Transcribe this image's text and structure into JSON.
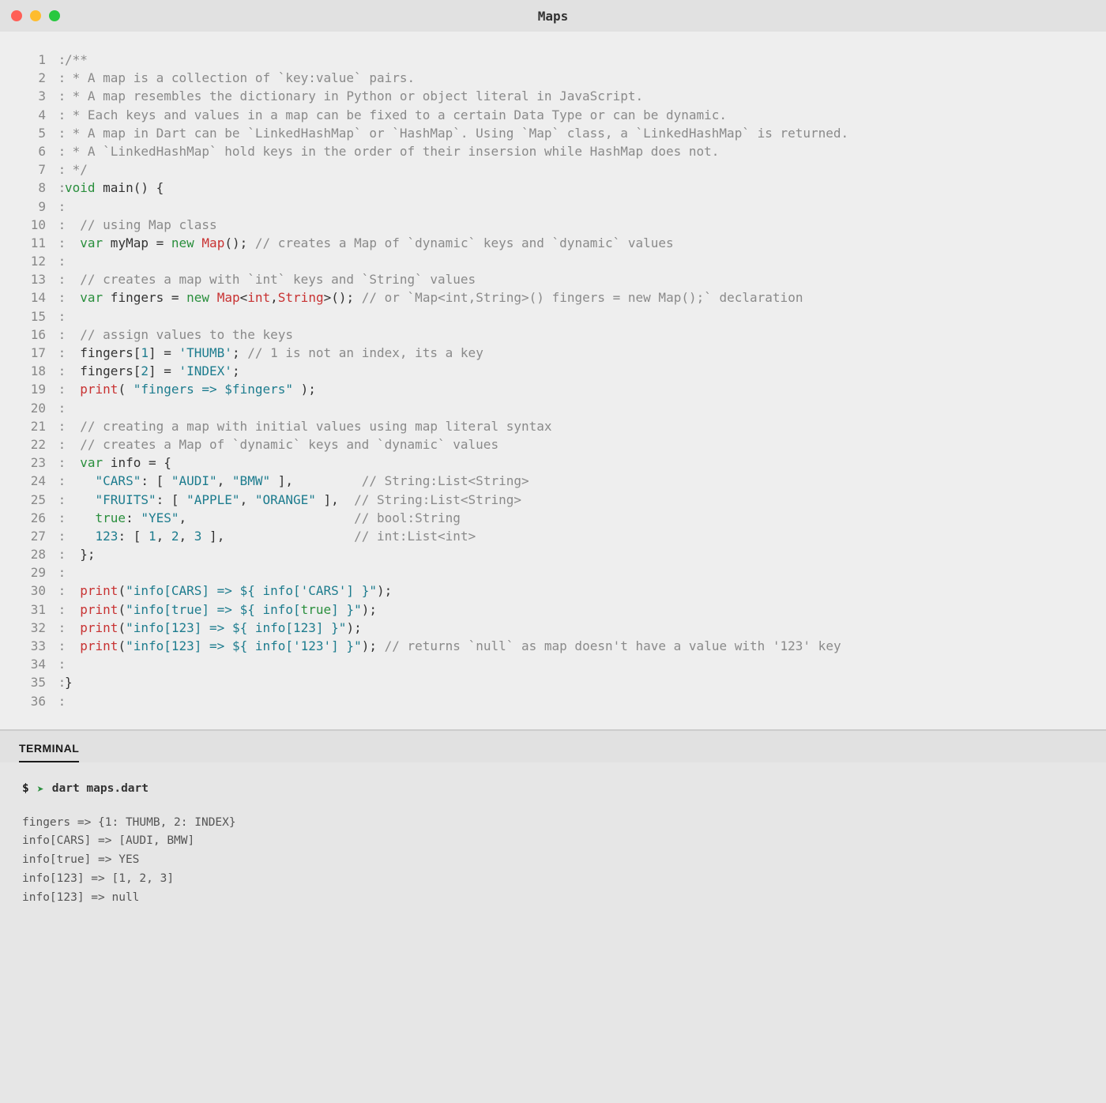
{
  "window": {
    "title": "Maps"
  },
  "gutter": {
    "sep": " :"
  },
  "code": [
    {
      "n": 1,
      "seg": [
        [
          "c-cmt",
          "/**"
        ]
      ]
    },
    {
      "n": 2,
      "seg": [
        [
          "c-cmt",
          " * A map is a collection of `key:value` pairs."
        ]
      ]
    },
    {
      "n": 3,
      "seg": [
        [
          "c-cmt",
          " * A map resembles the dictionary in Python or object literal in JavaScript."
        ]
      ]
    },
    {
      "n": 4,
      "seg": [
        [
          "c-cmt",
          " * Each keys and values in a map can be fixed to a certain Data Type or can be dynamic."
        ]
      ]
    },
    {
      "n": 5,
      "seg": [
        [
          "c-cmt",
          " * A map in Dart can be `LinkedHashMap` or `HashMap`. Using `Map` class, a `LinkedHashMap` is returned."
        ]
      ]
    },
    {
      "n": 6,
      "seg": [
        [
          "c-cmt",
          " * A `LinkedHashMap` hold keys in the order of their insersion while HashMap does not."
        ]
      ]
    },
    {
      "n": 7,
      "seg": [
        [
          "c-cmt",
          " */"
        ]
      ]
    },
    {
      "n": 8,
      "seg": [
        [
          "c-kw",
          "void"
        ],
        [
          "c-id",
          " main() {"
        ]
      ]
    },
    {
      "n": 9,
      "seg": []
    },
    {
      "n": 10,
      "seg": [
        [
          "c-id",
          "  "
        ],
        [
          "c-cmt",
          "// using Map class"
        ]
      ]
    },
    {
      "n": 11,
      "seg": [
        [
          "c-id",
          "  "
        ],
        [
          "c-kw",
          "var"
        ],
        [
          "c-id",
          " myMap = "
        ],
        [
          "c-kw",
          "new"
        ],
        [
          "c-id",
          " "
        ],
        [
          "c-ty",
          "Map"
        ],
        [
          "c-id",
          "(); "
        ],
        [
          "c-cmt",
          "// creates a Map of `dynamic` keys and `dynamic` values"
        ]
      ]
    },
    {
      "n": 12,
      "seg": []
    },
    {
      "n": 13,
      "seg": [
        [
          "c-id",
          "  "
        ],
        [
          "c-cmt",
          "// creates a map with `int` keys and `String` values"
        ]
      ]
    },
    {
      "n": 14,
      "seg": [
        [
          "c-id",
          "  "
        ],
        [
          "c-kw",
          "var"
        ],
        [
          "c-id",
          " fingers = "
        ],
        [
          "c-kw",
          "new"
        ],
        [
          "c-id",
          " "
        ],
        [
          "c-ty",
          "Map"
        ],
        [
          "c-id",
          "<"
        ],
        [
          "c-ty",
          "int"
        ],
        [
          "c-id",
          ","
        ],
        [
          "c-ty",
          "String"
        ],
        [
          "c-id",
          ">(); "
        ],
        [
          "c-cmt",
          "// or `Map<int,String>() fingers = new Map();` declaration"
        ]
      ]
    },
    {
      "n": 15,
      "seg": []
    },
    {
      "n": 16,
      "seg": [
        [
          "c-id",
          "  "
        ],
        [
          "c-cmt",
          "// assign values to the keys"
        ]
      ]
    },
    {
      "n": 17,
      "seg": [
        [
          "c-id",
          "  fingers["
        ],
        [
          "c-num",
          "1"
        ],
        [
          "c-id",
          "] = "
        ],
        [
          "c-str",
          "'THUMB'"
        ],
        [
          "c-id",
          "; "
        ],
        [
          "c-cmt",
          "// 1 is not an index, its a key"
        ]
      ]
    },
    {
      "n": 18,
      "seg": [
        [
          "c-id",
          "  fingers["
        ],
        [
          "c-num",
          "2"
        ],
        [
          "c-id",
          "] = "
        ],
        [
          "c-str",
          "'INDEX'"
        ],
        [
          "c-id",
          ";"
        ]
      ]
    },
    {
      "n": 19,
      "seg": [
        [
          "c-id",
          "  "
        ],
        [
          "c-ty",
          "print"
        ],
        [
          "c-id",
          "( "
        ],
        [
          "c-str",
          "\"fingers => $fingers\""
        ],
        [
          "c-id",
          " );"
        ]
      ]
    },
    {
      "n": 20,
      "seg": []
    },
    {
      "n": 21,
      "seg": [
        [
          "c-id",
          "  "
        ],
        [
          "c-cmt",
          "// creating a map with initial values using map literal syntax"
        ]
      ]
    },
    {
      "n": 22,
      "seg": [
        [
          "c-id",
          "  "
        ],
        [
          "c-cmt",
          "// creates a Map of `dynamic` keys and `dynamic` values"
        ]
      ]
    },
    {
      "n": 23,
      "seg": [
        [
          "c-id",
          "  "
        ],
        [
          "c-kw",
          "var"
        ],
        [
          "c-id",
          " info = {"
        ]
      ]
    },
    {
      "n": 24,
      "seg": [
        [
          "c-id",
          "    "
        ],
        [
          "c-str",
          "\"CARS\""
        ],
        [
          "c-id",
          ": [ "
        ],
        [
          "c-str",
          "\"AUDI\""
        ],
        [
          "c-id",
          ", "
        ],
        [
          "c-str",
          "\"BMW\""
        ],
        [
          "c-id",
          " ],         "
        ],
        [
          "c-cmt",
          "// String:List<String>"
        ]
      ]
    },
    {
      "n": 25,
      "seg": [
        [
          "c-id",
          "    "
        ],
        [
          "c-str",
          "\"FRUITS\""
        ],
        [
          "c-id",
          ": [ "
        ],
        [
          "c-str",
          "\"APPLE\""
        ],
        [
          "c-id",
          ", "
        ],
        [
          "c-str",
          "\"ORANGE\""
        ],
        [
          "c-id",
          " ],  "
        ],
        [
          "c-cmt",
          "// String:List<String>"
        ]
      ]
    },
    {
      "n": 26,
      "seg": [
        [
          "c-id",
          "    "
        ],
        [
          "c-bool",
          "true"
        ],
        [
          "c-id",
          ": "
        ],
        [
          "c-str",
          "\"YES\""
        ],
        [
          "c-id",
          ",                      "
        ],
        [
          "c-cmt",
          "// bool:String"
        ]
      ]
    },
    {
      "n": 27,
      "seg": [
        [
          "c-id",
          "    "
        ],
        [
          "c-num",
          "123"
        ],
        [
          "c-id",
          ": [ "
        ],
        [
          "c-num",
          "1"
        ],
        [
          "c-id",
          ", "
        ],
        [
          "c-num",
          "2"
        ],
        [
          "c-id",
          ", "
        ],
        [
          "c-num",
          "3"
        ],
        [
          "c-id",
          " ],                 "
        ],
        [
          "c-cmt",
          "// int:List<int>"
        ]
      ]
    },
    {
      "n": 28,
      "seg": [
        [
          "c-id",
          "  };"
        ]
      ]
    },
    {
      "n": 29,
      "seg": []
    },
    {
      "n": 30,
      "seg": [
        [
          "c-id",
          "  "
        ],
        [
          "c-ty",
          "print"
        ],
        [
          "c-id",
          "("
        ],
        [
          "c-str",
          "\"info[CARS] => ${ info['CARS'] }\""
        ],
        [
          "c-id",
          ");"
        ]
      ]
    },
    {
      "n": 31,
      "seg": [
        [
          "c-id",
          "  "
        ],
        [
          "c-ty",
          "print"
        ],
        [
          "c-id",
          "("
        ],
        [
          "c-str",
          "\"info[true] => ${ info["
        ],
        [
          "c-bool",
          "true"
        ],
        [
          "c-str",
          "] }\""
        ],
        [
          "c-id",
          ");"
        ]
      ]
    },
    {
      "n": 32,
      "seg": [
        [
          "c-id",
          "  "
        ],
        [
          "c-ty",
          "print"
        ],
        [
          "c-id",
          "("
        ],
        [
          "c-str",
          "\"info[123] => ${ info["
        ],
        [
          "c-num",
          "123"
        ],
        [
          "c-str",
          "] }\""
        ],
        [
          "c-id",
          ");"
        ]
      ]
    },
    {
      "n": 33,
      "seg": [
        [
          "c-id",
          "  "
        ],
        [
          "c-ty",
          "print"
        ],
        [
          "c-id",
          "("
        ],
        [
          "c-str",
          "\"info[123] => ${ info['123'] }\""
        ],
        [
          "c-id",
          "); "
        ],
        [
          "c-cmt",
          "// returns `null` as map doesn't have a value with '123' key"
        ]
      ]
    },
    {
      "n": 34,
      "seg": []
    },
    {
      "n": 35,
      "seg": [
        [
          "c-id",
          "}"
        ]
      ]
    },
    {
      "n": 36,
      "seg": []
    }
  ],
  "terminal": {
    "tab": "TERMINAL",
    "prompt": "$",
    "arrow": "➤",
    "command": "dart maps.dart",
    "output": [
      "fingers => {1: THUMB, 2: INDEX}",
      "info[CARS] => [AUDI, BMW]",
      "info[true] => YES",
      "info[123] => [1, 2, 3]",
      "info[123] => null"
    ]
  }
}
